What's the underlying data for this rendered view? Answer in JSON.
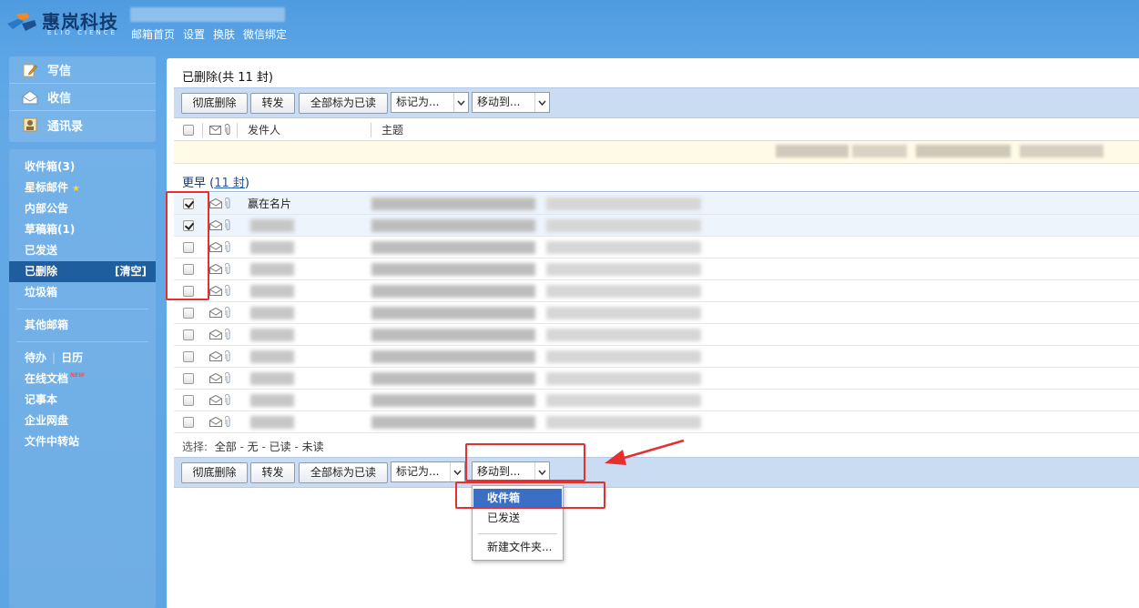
{
  "brand": {
    "name": "惠岚科技",
    "sub": "ELIO CIENCE"
  },
  "topnav": [
    "邮箱首页",
    "设置",
    "换肤",
    "微信绑定"
  ],
  "sidebar": {
    "quick": [
      {
        "label": "写信",
        "icon": "pencil-icon"
      },
      {
        "label": "收信",
        "icon": "inbox-icon"
      },
      {
        "label": "通讯录",
        "icon": "contacts-icon"
      }
    ],
    "folders": [
      {
        "label": "收件箱(3)"
      },
      {
        "label": "星标邮件"
      },
      {
        "label": "内部公告"
      },
      {
        "label": "草稿箱(1)"
      },
      {
        "label": "已发送"
      },
      {
        "label": "已删除",
        "aux": "[清空]"
      },
      {
        "label": "垃圾箱"
      }
    ],
    "other_mail": "其他邮箱",
    "tools_todo": "待办",
    "tools_calendar": "日历",
    "tools": [
      {
        "label": "在线文档",
        "tag": "NEW"
      },
      {
        "label": "记事本"
      },
      {
        "label": "企业网盘"
      },
      {
        "label": "文件中转站"
      }
    ]
  },
  "main": {
    "title_name": "已删除",
    "title_count": "(共 11 封)",
    "toolbar": {
      "delete_forever": "彻底删除",
      "forward": "转发",
      "mark_all_read": "全部标为已读",
      "mark_as": "标记为...",
      "move_to": "移动到..."
    },
    "columns": {
      "sender": "发件人",
      "subject": "主题"
    },
    "group": {
      "label": "更早",
      "count": "11 封"
    },
    "rows": [
      {
        "sender": "赢在名片",
        "checked": true
      },
      {
        "sender": "",
        "checked": true
      },
      {
        "sender": "",
        "checked": false
      },
      {
        "sender": "",
        "checked": false
      },
      {
        "sender": "",
        "checked": false
      },
      {
        "sender": "",
        "checked": false
      },
      {
        "sender": "",
        "checked": false
      },
      {
        "sender": "",
        "checked": false
      },
      {
        "sender": "",
        "checked": false
      },
      {
        "sender": "",
        "checked": false
      },
      {
        "sender": "",
        "checked": false
      }
    ],
    "select": {
      "prefix": "选择:",
      "all": "全部",
      "none": "无",
      "read": "已读",
      "unread": "未读"
    },
    "dropdown": {
      "items": [
        "收件箱",
        "已发送"
      ],
      "new_folder": "新建文件夹..."
    }
  },
  "colors": {
    "accent": "#3a6fc5",
    "annotation": "#e53030",
    "sidebar_bg": "#5ba5e6"
  }
}
